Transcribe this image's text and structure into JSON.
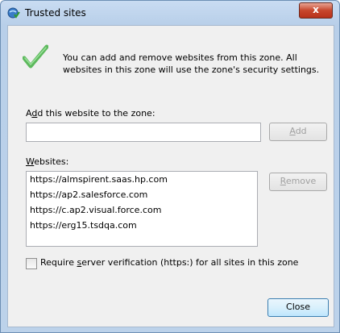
{
  "window": {
    "title": "Trusted sites",
    "close_glyph": "x"
  },
  "info": {
    "text": "You can add and remove websites from this zone. All websites in this zone will use the zone's security settings."
  },
  "add": {
    "label_pre": "A",
    "label_accel": "d",
    "label_post": "d this website to the zone:",
    "input_value": "",
    "button_accel": "A",
    "button_post": "dd"
  },
  "websites": {
    "label_accel": "W",
    "label_post": "ebsites:",
    "items": [
      "https://almspirent.saas.hp.com",
      "https://ap2.salesforce.com",
      "https://c.ap2.visual.force.com",
      "https://erg15.tsdqa.com"
    ],
    "remove_accel": "R",
    "remove_post": "emove"
  },
  "verify": {
    "pre": "Require ",
    "accel": "s",
    "post": "erver verification (https:) for all sites in this zone",
    "checked": false
  },
  "close_label": "Close"
}
